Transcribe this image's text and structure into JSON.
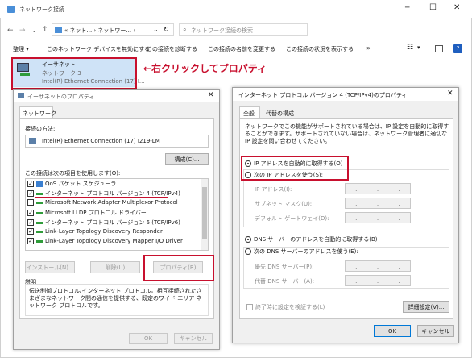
{
  "explorer": {
    "window_title": "ネットワーク接続",
    "address": "« ネット... › ネットワー... ›",
    "search_placeholder": "ネットワーク接続の検索",
    "toolbar": [
      "整理 ▾",
      "このネットワーク デバイスを無効にする",
      "この接続を診断する",
      "この接続の名前を変更する",
      "この接続の状況を表示する",
      "»"
    ],
    "adapter": {
      "name": "イーサネット",
      "network": "ネットワーク 3",
      "device": "Intel(R) Ethernet Connection (17) I..."
    }
  },
  "annotation": "←右クリックしてプロパティ",
  "props": {
    "title": "イーサネットのプロパティ",
    "tab": "ネットワーク",
    "connect_using_label": "接続の方法:",
    "adapter_name": "Intel(R) Ethernet Connection (17) I219-LM",
    "configure_button": "構成(C)...",
    "items_label": "この接続は次の項目を使用します(O):",
    "items": [
      "QoS パケット スケジューラ",
      "インターネット プロトコル バージョン 4 (TCP/IPv4)",
      "Microsoft Network Adapter Multiplexor Protocol",
      "Microsoft LLDP プロトコル ドライバー",
      "インターネット プロトコル バージョン 6 (TCP/IPv6)",
      "Link-Layer Topology Discovery Responder",
      "Link-Layer Topology Discovery Mapper I/O Driver"
    ],
    "install_button": "インストール(N)...",
    "uninstall_button": "削除(U)",
    "properties_button": "プロパティ(R)",
    "description_label": "説明",
    "description_text": "伝送制御プロトコル/インターネット プロトコル。相互接続されたさまざまなネットワーク間の通信を提供する、既定のワイド エリア ネットワーク プロトコルです。",
    "ok_button": "OK",
    "cancel_button": "キャンセル"
  },
  "ipv4": {
    "title": "インターネット プロトコル バージョン 4 (TCP/IPv4)のプロパティ",
    "tab_general": "全般",
    "tab_alternate": "代替の構成",
    "description": "ネットワークでこの機能がサポートされている場合は、IP 設定を自動的に取得することができます。サポートされていない場合は、ネットワーク管理者に適切な IP 設定を問い合わせてください。",
    "auto_ip": "IP アドレスを自動的に取得する(O)",
    "manual_ip": "次の IP アドレスを使う(S):",
    "ip_address_label": "IP アドレス(I):",
    "subnet_label": "サブネット マスク(U):",
    "gateway_label": "デフォルト ゲートウェイ(D):",
    "auto_dns": "DNS サーバーのアドレスを自動的に取得する(B)",
    "manual_dns": "次の DNS サーバーのアドレスを使う(E):",
    "preferred_dns_label": "優先 DNS サーバー(P):",
    "alternate_dns_label": "代替 DNS サーバー(A):",
    "validate_label": "終了時に設定を検証する(L)",
    "advanced_button": "詳細設定(V)...",
    "ok_button": "OK",
    "cancel_button": "キャンセル"
  }
}
